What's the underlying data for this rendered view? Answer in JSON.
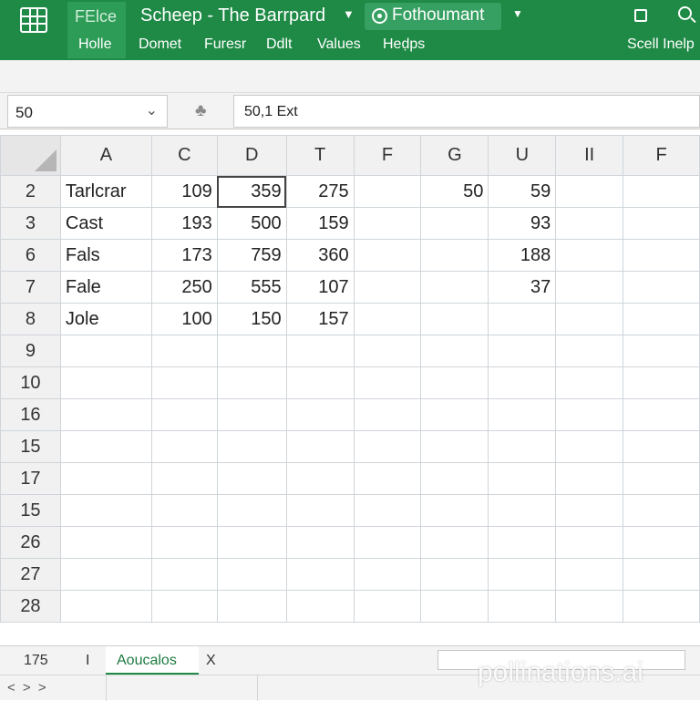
{
  "ribbon": {
    "file_tab": "FElce",
    "home_tab": "Holle",
    "title": "Scheep - The Barrpard",
    "account": "Fothoumant",
    "menu": [
      "Domet",
      "Furesr",
      "Ddlt",
      "Values",
      "Heḍps"
    ],
    "help": "Scell Inelp",
    "accent_color": "#1e8a46"
  },
  "formula_bar": {
    "name_box": "50",
    "formula": "50,1 Ext"
  },
  "grid": {
    "columns": [
      "A",
      "C",
      "D",
      "T",
      "F",
      "G",
      "U",
      "II",
      "F"
    ],
    "rows": [
      {
        "header": "2",
        "cells": [
          "Tarlcrar",
          "109",
          "359",
          "275",
          "",
          "50",
          "59",
          "",
          ""
        ]
      },
      {
        "header": "3",
        "cells": [
          "Cast",
          "193",
          "500",
          "159",
          "",
          "",
          "93",
          "",
          ""
        ]
      },
      {
        "header": "6",
        "cells": [
          "Fals",
          "173",
          "759",
          "360",
          "",
          "",
          "188",
          "",
          ""
        ]
      },
      {
        "header": "7",
        "cells": [
          "Fale",
          "250",
          "555",
          "107",
          "",
          "",
          "37",
          "",
          ""
        ]
      },
      {
        "header": "8",
        "cells": [
          "Jole",
          "100",
          "150",
          "157",
          "",
          "",
          "",
          "",
          ""
        ]
      },
      {
        "header": "9",
        "cells": [
          "",
          "",
          "",
          "",
          "",
          "",
          "",
          "",
          ""
        ]
      },
      {
        "header": "10",
        "cells": [
          "",
          "",
          "",
          "",
          "",
          "",
          "",
          "",
          ""
        ]
      },
      {
        "header": "16",
        "cells": [
          "",
          "",
          "",
          "",
          "",
          "",
          "",
          "",
          ""
        ]
      },
      {
        "header": "15",
        "cells": [
          "",
          "",
          "",
          "",
          "",
          "",
          "",
          "",
          ""
        ]
      },
      {
        "header": "17",
        "cells": [
          "",
          "",
          "",
          "",
          "",
          "",
          "",
          "",
          ""
        ]
      },
      {
        "header": "15",
        "cells": [
          "",
          "",
          "",
          "",
          "",
          "",
          "",
          "",
          ""
        ]
      },
      {
        "header": "26",
        "cells": [
          "",
          "",
          "",
          "",
          "",
          "",
          "",
          "",
          ""
        ]
      },
      {
        "header": "27",
        "cells": [
          "",
          "",
          "",
          "",
          "",
          "",
          "",
          "",
          ""
        ]
      },
      {
        "header": "28",
        "cells": [
          "",
          "",
          "",
          "",
          "",
          "",
          "",
          "",
          ""
        ]
      }
    ]
  },
  "sheet_bar": {
    "info": "175",
    "separator": "I",
    "active_sheet": "Aoucalos",
    "close": "X"
  },
  "status_bar": {
    "nav": "< > >"
  },
  "watermark": "pollinations.ai"
}
